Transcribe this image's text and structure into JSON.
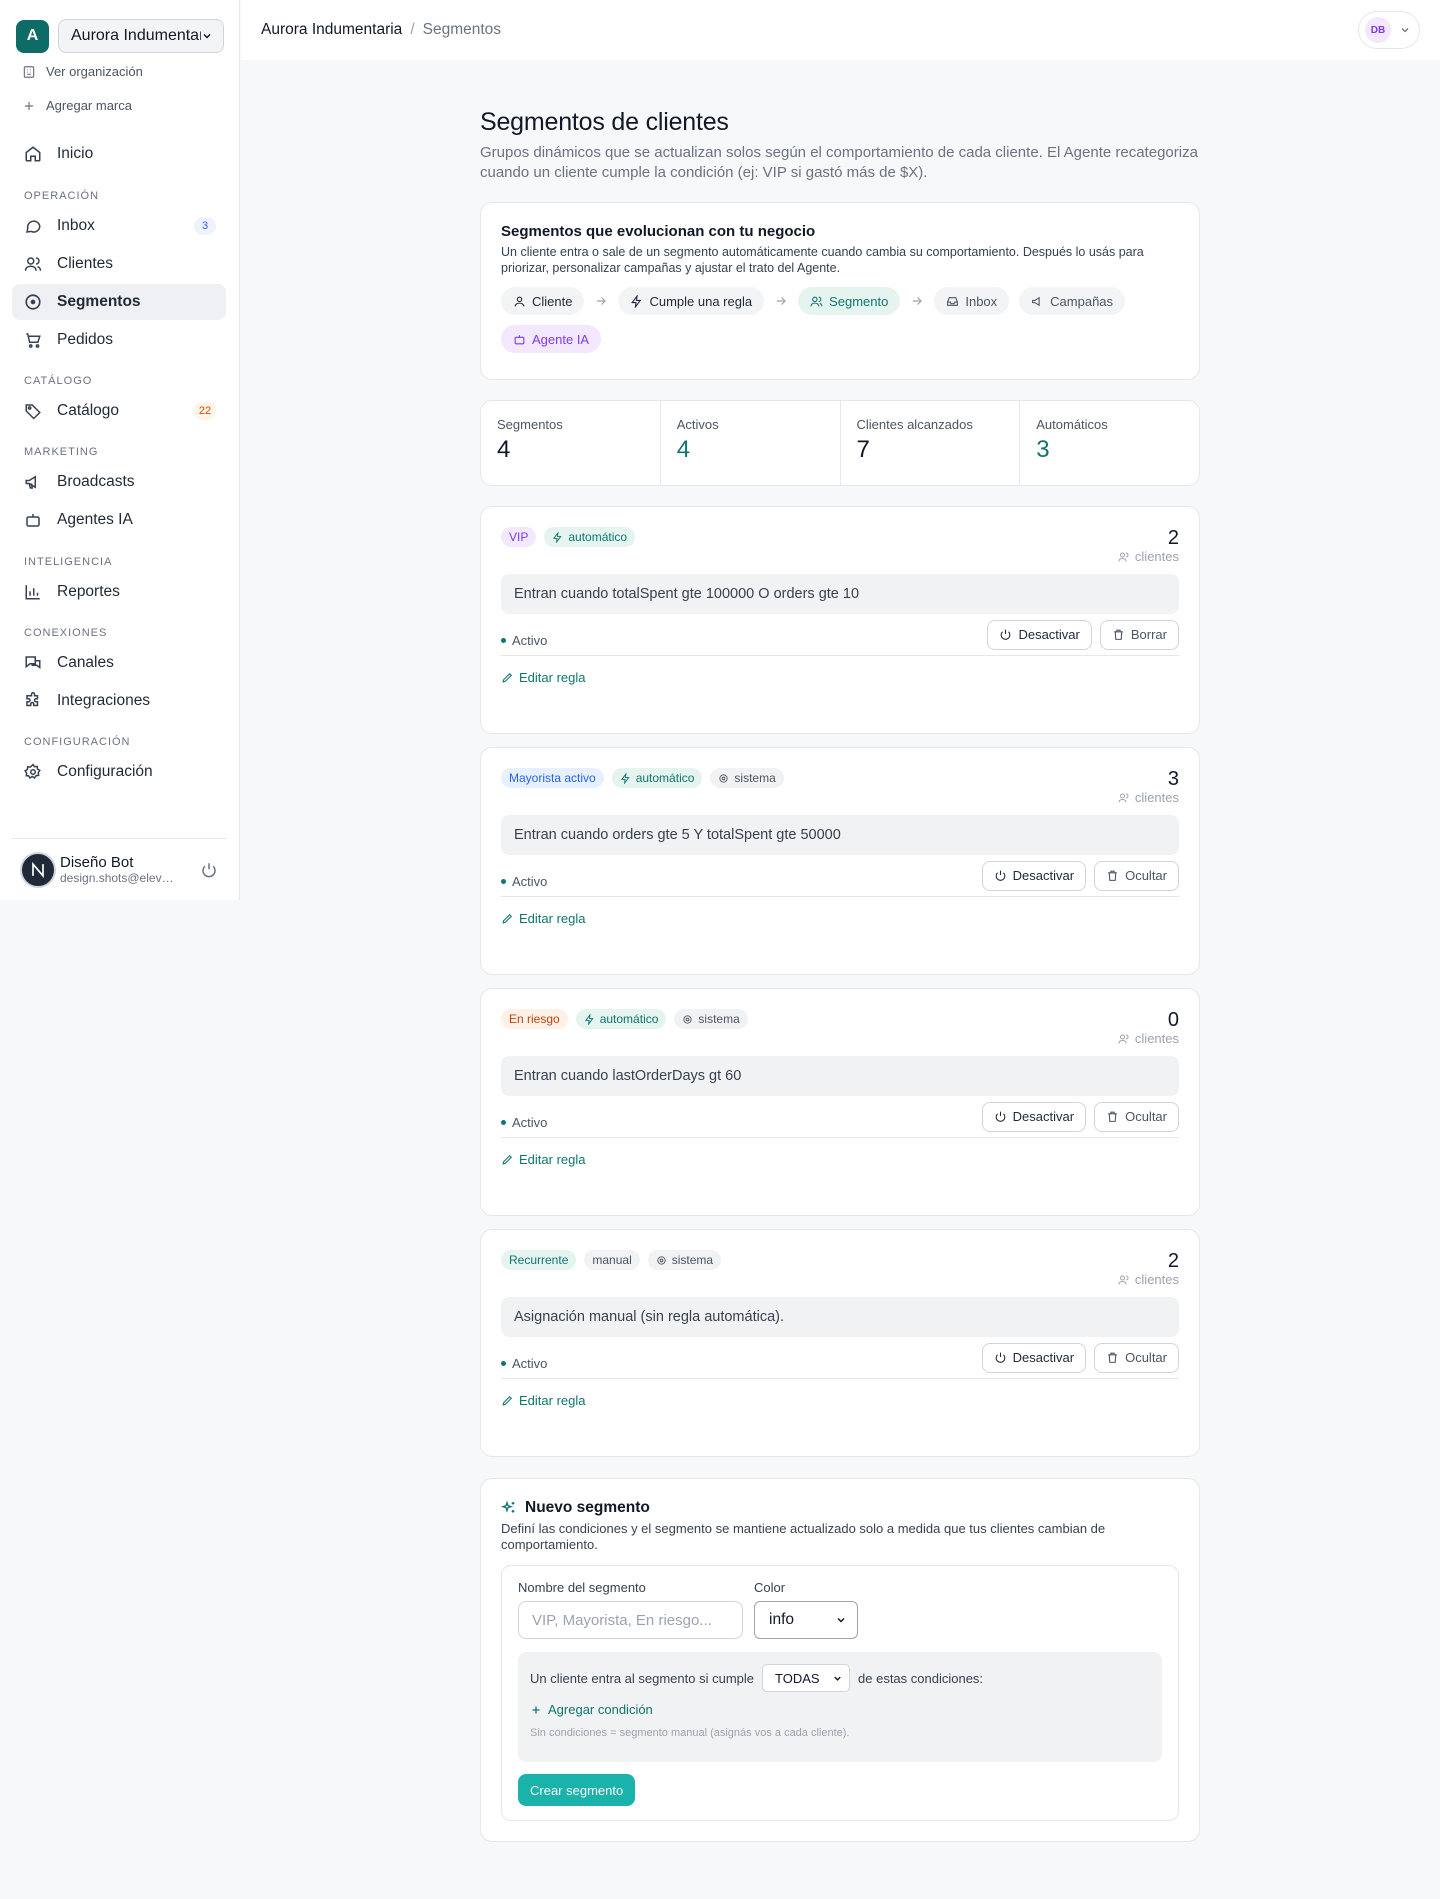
{
  "sidebar": {
    "org_initial": "A",
    "org_name": "Aurora Indumentaria",
    "view_org": "Ver organización",
    "add_brand": "Agregar marca",
    "inicio": "Inicio",
    "sections": {
      "operacion": "OPERACIÓN",
      "catalogo": "CATÁLOGO",
      "marketing": "MARKETING",
      "inteligencia": "INTELIGENCIA",
      "conexiones": "CONEXIONES",
      "configuracion": "CONFIGURACIÓN"
    },
    "items": {
      "inbox": "Inbox",
      "inbox_badge": "3",
      "clientes": "Clientes",
      "segmentos": "Segmentos",
      "pedidos": "Pedidos",
      "catalogo": "Catálogo",
      "catalogo_badge": "22",
      "broadcasts": "Broadcasts",
      "agentes": "Agentes IA",
      "reportes": "Reportes",
      "canales": "Canales",
      "integraciones": "Integraciones",
      "configuracion": "Configuración"
    },
    "user": {
      "initial": "N",
      "name": "Diseño Bot",
      "email": "design.shots@eleva.app"
    }
  },
  "topbar": {
    "breadcrumb_org": "Aurora Indumentaria",
    "breadcrumb_sep": "/",
    "breadcrumb_page": "Segmentos",
    "account_initials": "DB"
  },
  "page": {
    "title": "Segmentos de clientes",
    "lead": "Grupos dinámicos que se actualizan solos según el comportamiento de cada cliente. El Agente recategoriza cuando un cliente cumple la condición (ej: VIP si gastó más de $X)."
  },
  "flow": {
    "title": "Segmentos que evolucionan con tu negocio",
    "desc": "Un cliente entra o sale de un segmento automáticamente cuando cambia su comportamiento. Después lo usás para priorizar, personalizar campañas y ajustar el trato del Agente.",
    "chips": {
      "cliente": "Cliente",
      "regla": "Cumple una regla",
      "segmento": "Segmento",
      "inbox": "Inbox",
      "campanas": "Campañas",
      "agente": "Agente IA"
    }
  },
  "stats": [
    {
      "label": "Segmentos",
      "value": "4"
    },
    {
      "label": "Activos",
      "value": "4"
    },
    {
      "label": "Clientes alcanzados",
      "value": "7"
    },
    {
      "label": "Automáticos",
      "value": "3"
    }
  ],
  "segments": [
    {
      "name": "VIP",
      "auto": "automático",
      "system": "",
      "count": "2",
      "count_label": "clientes",
      "rule": "Entran cuando totalSpent gte 100000 O orders gte 10",
      "status": "Activo",
      "deactivate": "Desactivar",
      "remove": "Borrar",
      "edit": "Editar regla"
    },
    {
      "name": "Mayorista activo",
      "auto": "automático",
      "system": "sistema",
      "count": "3",
      "count_label": "clientes",
      "rule": "Entran cuando orders gte 5 Y totalSpent gte 50000",
      "status": "Activo",
      "deactivate": "Desactivar",
      "remove": "Ocultar",
      "edit": "Editar regla"
    },
    {
      "name": "En riesgo",
      "auto": "automático",
      "system": "sistema",
      "count": "0",
      "count_label": "clientes",
      "rule": "Entran cuando lastOrderDays gt 60",
      "status": "Activo",
      "deactivate": "Desactivar",
      "remove": "Ocultar",
      "edit": "Editar regla"
    },
    {
      "name": "Recurrente",
      "auto": "manual",
      "system": "sistema",
      "count": "2",
      "count_label": "clientes",
      "rule": "Asignación manual (sin regla automática).",
      "status": "Activo",
      "deactivate": "Desactivar",
      "remove": "Ocultar",
      "edit": "Editar regla"
    }
  ],
  "new_segment": {
    "title": "Nuevo segmento",
    "desc": "Definí las condiciones y el segmento se mantiene actualizado solo a medida que tus clientes cambian de comportamiento.",
    "name_label": "Nombre del segmento",
    "name_placeholder": "VIP, Mayorista, En riesgo...",
    "color_label": "Color",
    "color_value": "info",
    "cond_prefix": "Un cliente entra al segmento si cumple",
    "cond_mode": "TODAS",
    "cond_suffix": "de estas condiciones:",
    "add_condition": "Agregar condición",
    "hint": "Sin condiciones = segmento manual (asignás vos a cada cliente).",
    "create": "Crear segmento"
  },
  "colors": {
    "accent": "#0f766e",
    "primary_button": "#1ab3ac",
    "org_avatar": "#0f6b66"
  }
}
